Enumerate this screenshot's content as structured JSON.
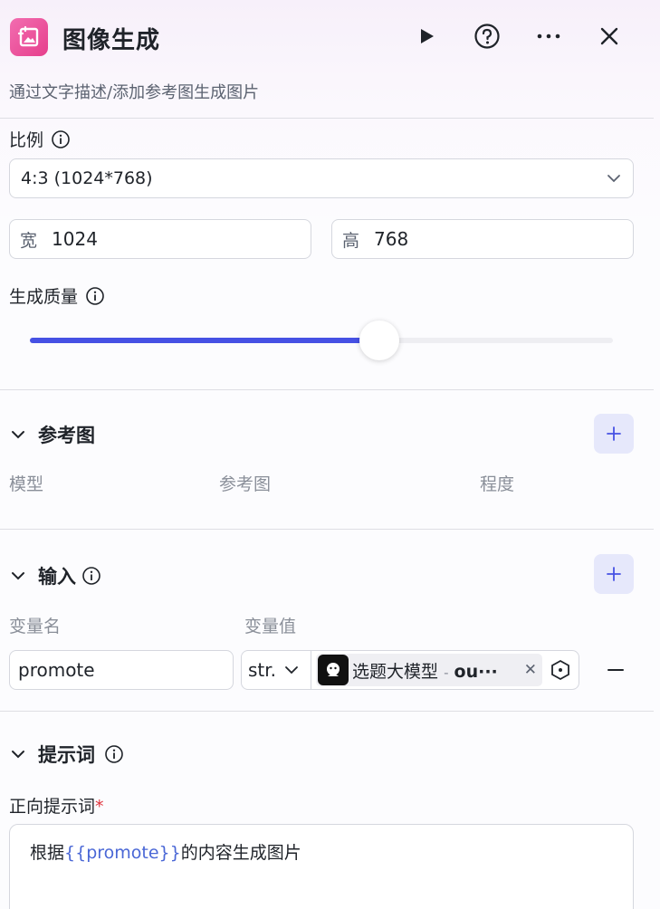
{
  "header": {
    "title": "图像生成",
    "subtitle": "通过文字描述/添加参考图生成图片",
    "icons": [
      "image-generate-icon",
      "play-icon",
      "help-icon",
      "more-icon",
      "close-icon"
    ]
  },
  "ratio": {
    "label": "比例",
    "selected": "4:3 (1024*768)",
    "width_prefix": "宽",
    "width_value": "1024",
    "height_prefix": "高",
    "height_value": "768"
  },
  "quality": {
    "label": "生成质量",
    "slider_value_fraction": 0.6
  },
  "reference": {
    "title": "参考图",
    "columns": [
      "模型",
      "参考图",
      "程度"
    ]
  },
  "input": {
    "title": "输入",
    "columns": [
      "变量名",
      "变量值"
    ],
    "rows": [
      {
        "name": "promote",
        "type": "str.",
        "ref_node": "选题大模型",
        "ref_sep": "-",
        "ref_field": "ou···"
      }
    ]
  },
  "prompt": {
    "title": "提示词",
    "positive_label": "正向提示词",
    "required_mark": "*",
    "text_before": "根据",
    "text_var": "{{promote}}",
    "text_after": "的内容生成图片"
  },
  "colors": {
    "accent": "#4651e4",
    "brand_pink": "#e63f8c",
    "plus_bg": "#e6e8fb",
    "variable_text": "#4a67d6"
  }
}
